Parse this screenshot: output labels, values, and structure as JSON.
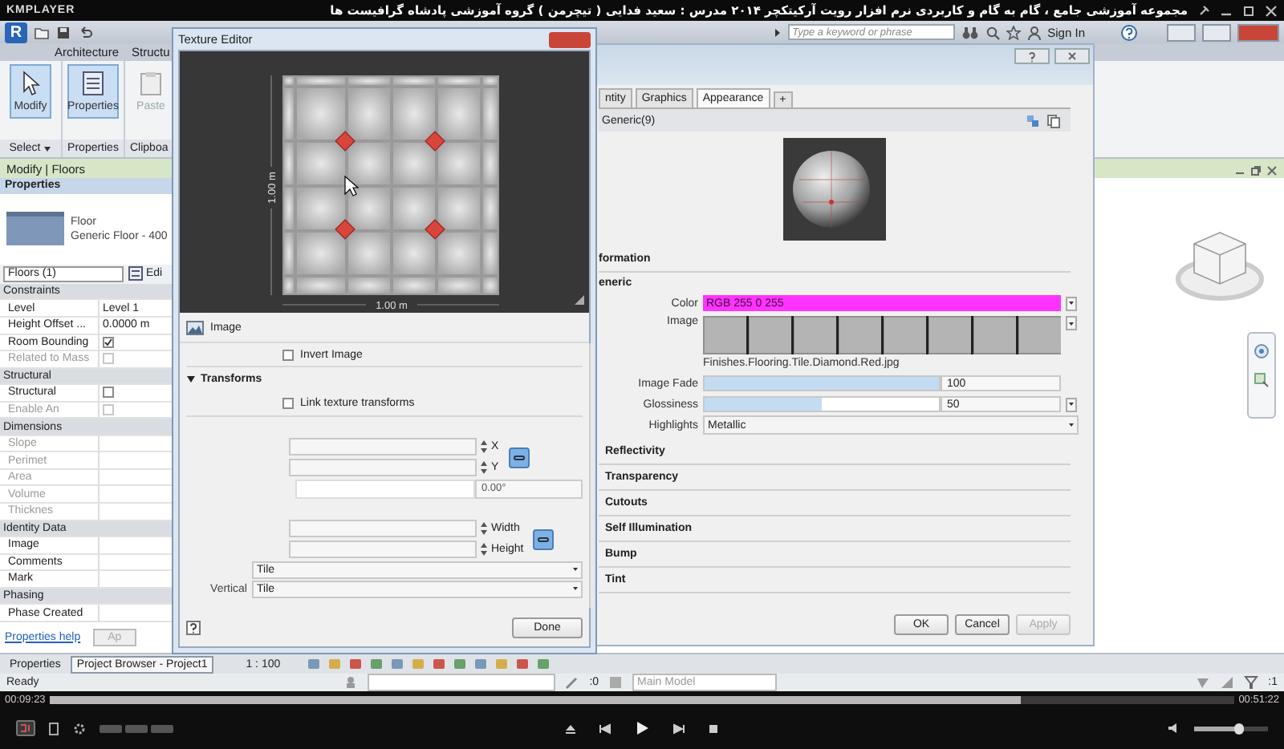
{
  "player": {
    "logo": "KMPLAYER",
    "title": "مجموعه آموزشی جامع ، گام به گام و کاربردی نرم افزار رویت آرکیتکچر ۲۰۱۴   مدرس : سعید فدایی ( تیچرمن ) گروه آموزشی پادشاه گرافیست ها",
    "time_elapsed": "00:09:23",
    "time_total": "00:51:22",
    "progress": {
      "level": 0.82
    },
    "volume": {
      "level": 0.6
    }
  },
  "revit": {
    "app_logo": "R",
    "search": {
      "placeholder": "Type a keyword or phrase"
    },
    "sign_in": "Sign In",
    "ribbon_tabs": [
      {
        "label": "Architecture",
        "selected": false
      },
      {
        "label": "Structu",
        "selected": false
      }
    ],
    "ribbon_buttons": [
      {
        "label": "Modify",
        "selected": true,
        "disabled": false
      },
      {
        "label": "Properties",
        "selected": true,
        "disabled": false
      },
      {
        "label": "Paste",
        "selected": false,
        "disabled": true
      }
    ],
    "panel_labels": [
      "Select",
      "Properties",
      "Clipboa"
    ],
    "context_bar": "Modify | Floors",
    "properties": {
      "title": "Properties",
      "type_name": "Floor",
      "type_detail": "Generic Floor - 400",
      "selector": "Floors (1)",
      "edit_type": "Edi",
      "rows": [
        {
          "kind": "group",
          "label": "Constraints"
        },
        {
          "kind": "text",
          "label": "Level",
          "value": "Level 1",
          "disabled": false
        },
        {
          "kind": "text",
          "label": "Height Offset ...",
          "value": "0.0000 m",
          "disabled": false
        },
        {
          "kind": "checkbox",
          "label": "Room Bounding",
          "checked": true,
          "disabled": false
        },
        {
          "kind": "checkbox",
          "label": "Related to Mass",
          "checked": false,
          "disabled": true
        },
        {
          "kind": "group",
          "label": "Structural"
        },
        {
          "kind": "checkbox",
          "label": "Structural",
          "checked": false,
          "disabled": false
        },
        {
          "kind": "checkbox",
          "label": "Enable An",
          "checked": false,
          "disabled": true
        },
        {
          "kind": "group",
          "label": "Dimensions"
        },
        {
          "kind": "text",
          "label": "Slope",
          "disabled": true
        },
        {
          "kind": "text",
          "label": "Perimet",
          "disabled": true
        },
        {
          "kind": "text",
          "label": "Area",
          "disabled": true
        },
        {
          "kind": "text",
          "label": "Volume",
          "disabled": true
        },
        {
          "kind": "text",
          "label": "Thicknes",
          "disabled": true
        },
        {
          "kind": "group",
          "label": "Identity Data"
        },
        {
          "kind": "text",
          "label": "Image",
          "disabled": false
        },
        {
          "kind": "text",
          "label": "Comments",
          "disabled": false
        },
        {
          "kind": "text",
          "label": "Mark",
          "disabled": false
        },
        {
          "kind": "group",
          "label": "Phasing"
        },
        {
          "kind": "text",
          "label": "Phase Created",
          "disabled": false
        }
      ],
      "help_link": "Properties help",
      "apply": "Ap"
    },
    "browser_tabs": [
      {
        "label": "Properties",
        "selected": false
      },
      {
        "label": "Project Browser - Project1",
        "selected": true
      }
    ],
    "scale": "1 : 100",
    "status": {
      "text": "Ready",
      "model": "Main Model",
      "left_count": ":0",
      "right_count": ":1"
    }
  },
  "material_editor": {
    "tabs": [
      {
        "label": "ntity",
        "selected": false
      },
      {
        "label": "Graphics",
        "selected": false
      },
      {
        "label": "Appearance",
        "selected": true
      }
    ],
    "add_tab": "+",
    "asset_name": "Generic(9)",
    "info_title": "formation",
    "generic_title": "eneric",
    "params": [
      {
        "kind": "color",
        "label": "Color",
        "value": "RGB 255 0 255",
        "color": "#ff33ff"
      },
      {
        "kind": "image",
        "label": "Image",
        "file": "Finishes.Flooring.Tile.Diamond.Red.jpg"
      },
      {
        "kind": "slider",
        "label": "Image Fade",
        "value": "100",
        "level": 1.0
      },
      {
        "kind": "slider",
        "label": "Glossiness",
        "value": "50",
        "level": 0.5
      },
      {
        "kind": "dropdown",
        "label": "Highlights",
        "value": "Metallic"
      }
    ],
    "sections": [
      "Reflectivity",
      "Transparency",
      "Cutouts",
      "Self Illumination",
      "Bump",
      "Tint"
    ],
    "buttons": [
      {
        "label": "OK",
        "disabled": false
      },
      {
        "label": "Cancel",
        "disabled": false
      },
      {
        "label": "Apply",
        "disabled": true
      }
    ]
  },
  "texture_editor": {
    "title": "Texture Editor",
    "dim_vertical": "1.00 m",
    "dim_horizontal": "1.00 m",
    "source_label": "Image",
    "invert": {
      "label": "Invert Image",
      "checked": false
    },
    "transforms_title": "Transforms",
    "link": {
      "label": "Link texture transforms",
      "checked": false
    },
    "rows": [
      {
        "kind": "pair",
        "labels": [
          "X",
          "Y"
        ]
      },
      {
        "kind": "angle",
        "value": "0.00°"
      },
      {
        "kind": "pair",
        "labels": [
          "Width",
          "Height"
        ]
      },
      {
        "kind": "select",
        "value": "Tile"
      },
      {
        "kind": "select",
        "label": "Vertical",
        "value": "Tile"
      }
    ],
    "done": "Done"
  }
}
